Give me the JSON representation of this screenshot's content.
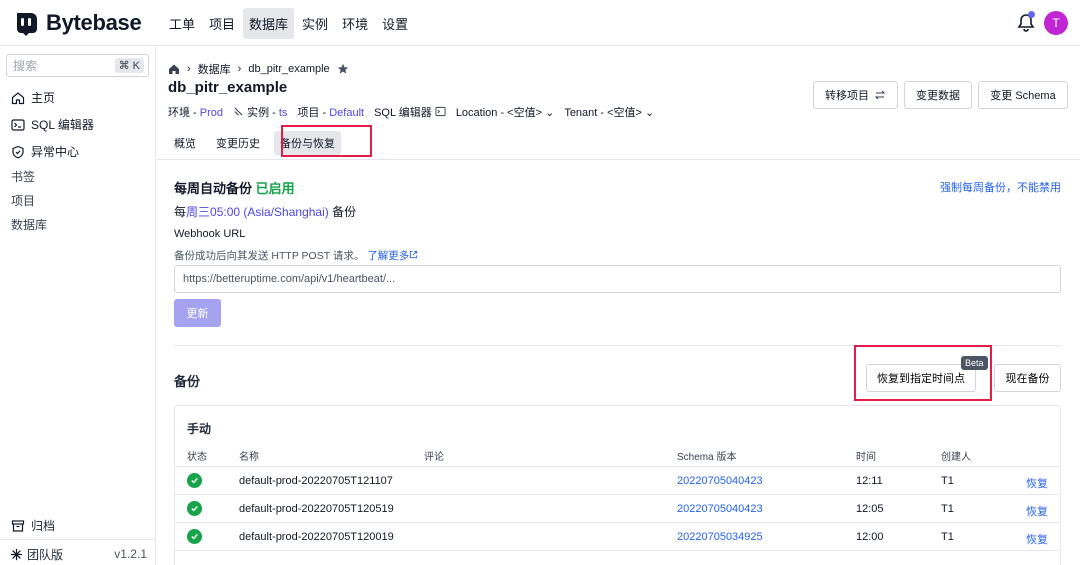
{
  "app": {
    "name": "Bytebase"
  },
  "topnav": {
    "items": [
      "工单",
      "项目",
      "数据库",
      "实例",
      "环境",
      "设置"
    ],
    "active_index": 2
  },
  "user": {
    "avatar_letter": "T"
  },
  "sidebar": {
    "search_placeholder": "搜索",
    "shortcut": "⌘ K",
    "items": [
      "主页",
      "SQL 编辑器",
      "异常中心"
    ],
    "sections": [
      "书签",
      "项目",
      "数据库"
    ],
    "archive": "归档",
    "plan": "团队版",
    "version": "v1.2.1"
  },
  "breadcrumb": {
    "section": "数据库",
    "current": "db_pitr_example"
  },
  "database": {
    "title": "db_pitr_example",
    "env_label": "环境 - ",
    "env_value": "Prod",
    "instance_label": "实例 - ",
    "instance_value": "ts",
    "project_label": "项目 - ",
    "project_value": "Default",
    "sql_editor": "SQL 编辑器",
    "location": "Location - <空值>",
    "tenant": "Tenant - <空值>"
  },
  "header_buttons": {
    "transfer": "转移项目",
    "change_data": "变更数据",
    "change_schema": "变更 Schema"
  },
  "tabs": [
    "概览",
    "变更历史",
    "备份与恢复"
  ],
  "weekly_backup": {
    "title": "每周自动备份",
    "status": "已启用",
    "force_note": "强制每周备份，不能禁用",
    "schedule_prefix": "每",
    "schedule_time": "周三05:00 (Asia/Shanghai)",
    "schedule_suffix": " 备份",
    "webhook_label": "Webhook URL",
    "webhook_desc": "备份成功后向其发送 HTTP POST 请求。",
    "learn_more": "了解更多",
    "webhook_placeholder": "https://betteruptime.com/api/v1/heartbeat/...",
    "update_button": "更新"
  },
  "backup": {
    "title": "备份",
    "pitr_button": "恢复到指定时间点",
    "beta": "Beta",
    "now_button": "现在备份",
    "manual_title": "手动",
    "columns": [
      "状态",
      "名称",
      "评论",
      "Schema 版本",
      "时间",
      "创建人"
    ],
    "rows": [
      {
        "name": "default-prod-20220705T121107",
        "comment": "",
        "schema_version": "20220705040423",
        "time": "12:11",
        "creator": "T1",
        "action": "恢复"
      },
      {
        "name": "default-prod-20220705T120519",
        "comment": "",
        "schema_version": "20220705040423",
        "time": "12:05",
        "creator": "T1",
        "action": "恢复"
      },
      {
        "name": "default-prod-20220705T120019",
        "comment": "",
        "schema_version": "20220705034925",
        "time": "12:00",
        "creator": "T1",
        "action": "恢复"
      }
    ]
  },
  "colors": {
    "accent": "#4f46e5",
    "success": "#16a34a",
    "highlight": "#e11d48",
    "link": "#2563eb"
  }
}
